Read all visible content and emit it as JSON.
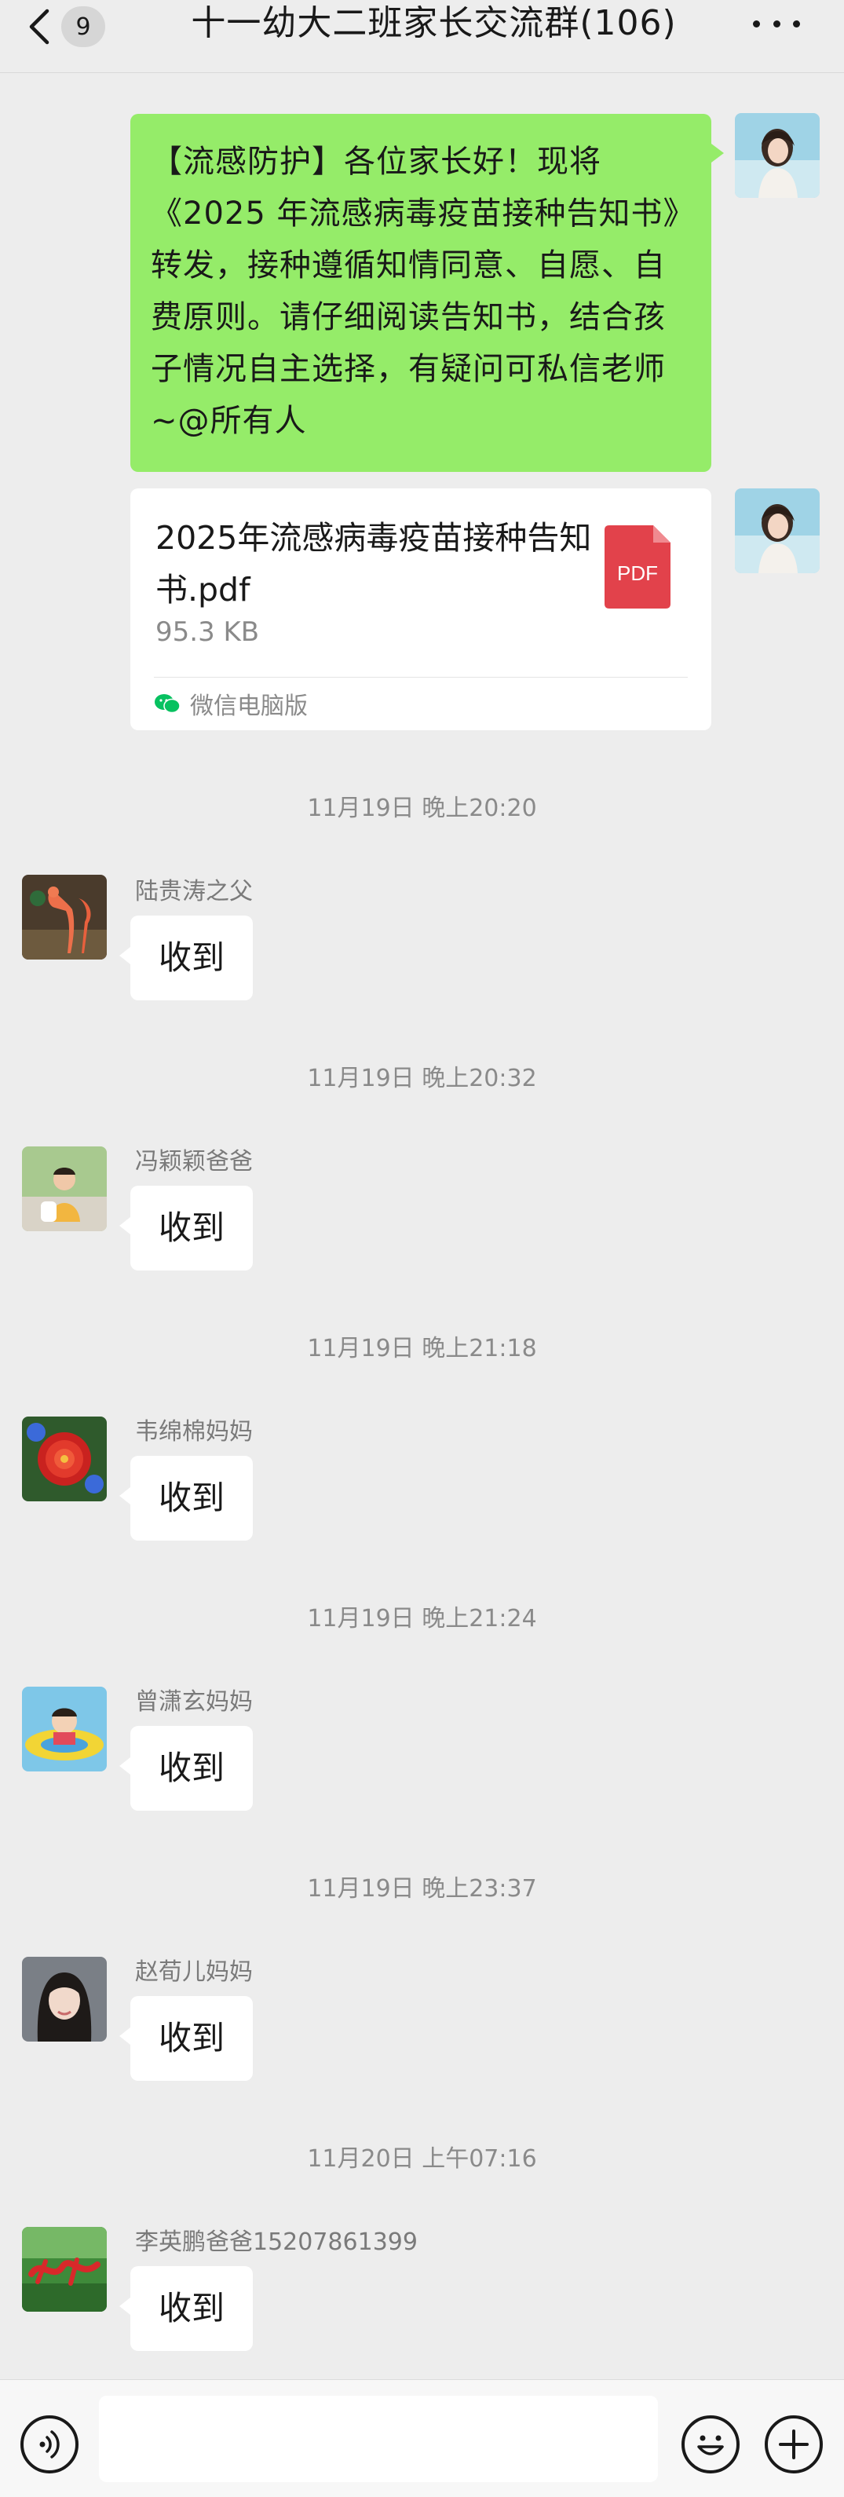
{
  "header": {
    "unread_count": "9",
    "title": "十一幼大二班家长交流群(106)"
  },
  "sent_message": {
    "text": "【流感防护】各位家长好！现将《2025 年流感病毒疫苗接种告知书》转发，接种遵循知情同意、自愿、自费原则。请仔细阅读告知书，结合孩子情况自主选择，有疑问可私信老师 ~@所有人"
  },
  "file_message": {
    "file_name": "2025年流感病毒疫苗接种告知书.pdf",
    "file_size": "95.3 KB",
    "file_type": "PDF",
    "source": "微信电脑版"
  },
  "received_messages": [
    {
      "timestamp": "11月19日 晚上20:20",
      "sender": "陆贵涛之父",
      "text": "收到"
    },
    {
      "timestamp": "11月19日 晚上20:32",
      "sender": "冯颖颖爸爸",
      "text": "收到"
    },
    {
      "timestamp": "11月19日 晚上21:18",
      "sender": "韦绵棉妈妈",
      "text": "收到"
    },
    {
      "timestamp": "11月19日 晚上21:24",
      "sender": "曾潇玄妈妈",
      "text": "收到"
    },
    {
      "timestamp": "11月19日 晚上23:37",
      "sender": "赵荀儿妈妈",
      "text": "收到"
    },
    {
      "timestamp": "11月20日 上午07:16",
      "sender": "李英鹏爸爸15207861399",
      "text": "收到"
    }
  ],
  "input": {
    "value": ""
  },
  "colors": {
    "background": "#ededed",
    "sent_bubble": "#95ec69",
    "received_bubble": "#ffffff",
    "pdf_red": "#e2424b",
    "wechat_green": "#07c160"
  },
  "icons": {
    "back": "chevron-left-icon",
    "more": "more-dots-icon",
    "pdf": "pdf-file-icon",
    "source": "wechat-icon",
    "voice": "voice-icon",
    "emoji": "emoji-icon",
    "plus": "plus-icon"
  }
}
